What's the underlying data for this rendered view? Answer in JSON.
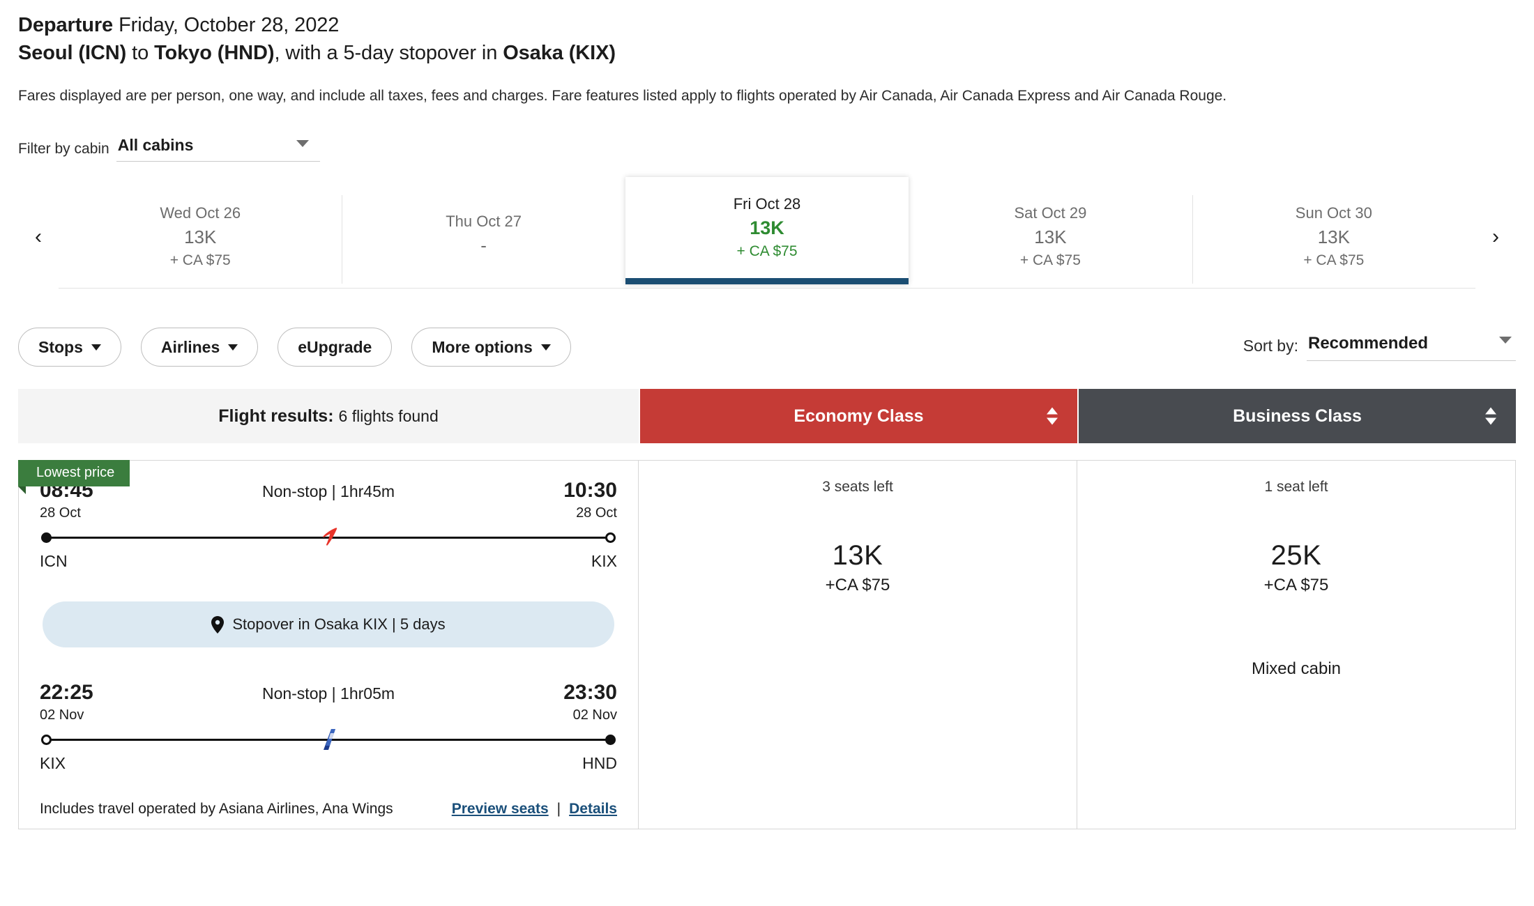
{
  "header": {
    "departure_label": "Departure",
    "departure_date": "Friday, October 28, 2022",
    "route_from": "Seoul (ICN)",
    "route_to_connector": " to ",
    "route_to": "Tokyo (HND)",
    "route_middle": ", with a 5-day stopover in ",
    "route_stopover": "Osaka (KIX)",
    "disclaimer": "Fares displayed are per person, one way, and include all taxes, fees and charges. Fare features listed apply to flights operated by Air Canada, Air Canada Express and Air Canada Rouge."
  },
  "cabin_filter": {
    "label": "Filter by cabin",
    "value": "All cabins"
  },
  "carousel": {
    "prev": "‹",
    "next": "›",
    "days": [
      {
        "date": "Wed Oct 26",
        "points": "13K",
        "cash": "+ CA $75",
        "selected": false
      },
      {
        "date": "Thu Oct 27",
        "points": "-",
        "cash": "",
        "selected": false
      },
      {
        "date": "Fri Oct 28",
        "points": "13K",
        "cash": "+ CA $75",
        "selected": true
      },
      {
        "date": "Sat Oct 29",
        "points": "13K",
        "cash": "+ CA $75",
        "selected": false
      },
      {
        "date": "Sun Oct 30",
        "points": "13K",
        "cash": "+ CA $75",
        "selected": false
      }
    ]
  },
  "filters": {
    "stops": "Stops",
    "airlines": "Airlines",
    "eupgrade": "eUpgrade",
    "more_options": "More options",
    "sort_label": "Sort by:",
    "sort_value": "Recommended"
  },
  "results_header": {
    "title": "Flight results:",
    "count": "6 flights found",
    "economy": "Economy Class",
    "business": "Business Class"
  },
  "flight": {
    "badge": "Lowest price",
    "segment1": {
      "depart_time": "08:45",
      "depart_date": "28 Oct",
      "middle": "Non-stop | 1hr45m",
      "arrive_time": "10:30",
      "arrive_date": "28 Oct",
      "origin": "ICN",
      "destination": "KIX",
      "carrier_icon": "asiana-logo-icon"
    },
    "stopover": "Stopover in Osaka KIX | 5 days",
    "segment2": {
      "depart_time": "22:25",
      "depart_date": "02 Nov",
      "middle": "Non-stop | 1hr05m",
      "arrive_time": "23:30",
      "arrive_date": "02 Nov",
      "origin": "KIX",
      "destination": "HND",
      "carrier_icon": "ana-logo-icon"
    },
    "operated_by": "Includes travel operated by Asiana Airlines, Ana Wings",
    "preview_seats": "Preview seats",
    "link_separator": "|",
    "details": "Details",
    "economy_fare": {
      "seats": "3 seats left",
      "points": "13K",
      "cash": "+CA $75",
      "note": ""
    },
    "business_fare": {
      "seats": "1 seat left",
      "points": "25K",
      "cash": "+CA $75",
      "note": "Mixed cabin"
    }
  },
  "colors": {
    "economy_bar": "#c53b36",
    "business_bar": "#484b50",
    "badge_green": "#3b7d3e",
    "selected_underline": "#1b4e73",
    "price_green": "#2e8b31",
    "link_blue": "#1a4f7a",
    "stopover_bg": "#dce9f2"
  }
}
